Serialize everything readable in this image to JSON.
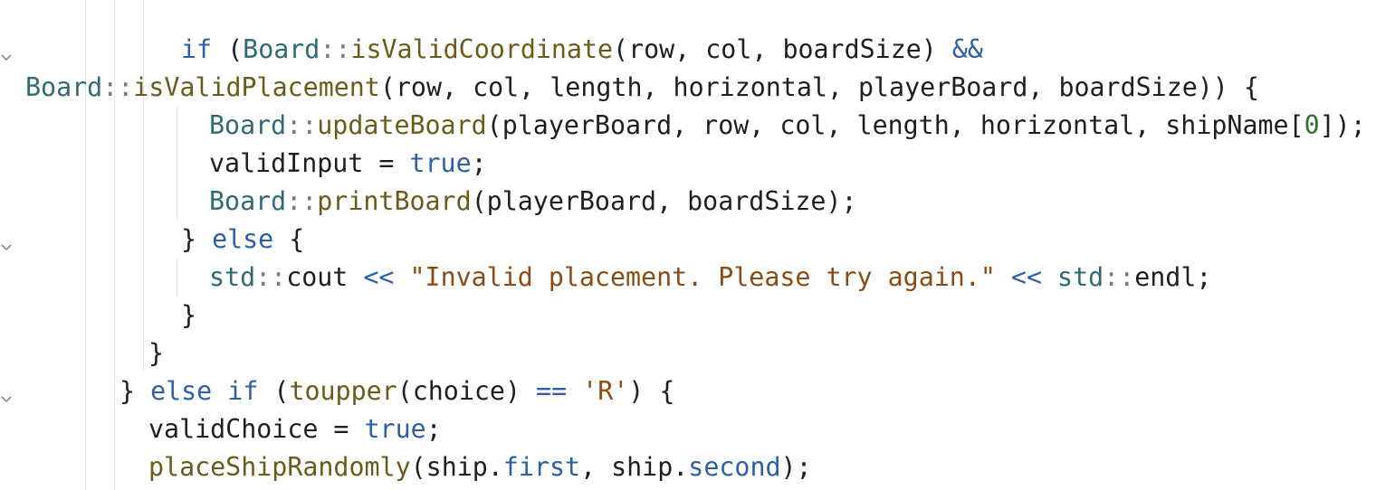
{
  "editor": {
    "colors": {
      "keyword": "#2b5fa8",
      "type": "#2e6a76",
      "function": "#6b5b1b",
      "string": "#8a4b14",
      "number": "#2f6e2f",
      "plain": "#1f1f1f"
    },
    "fold_markers": [
      "chevron-down-icon",
      "chevron-down-icon",
      "chevron-down-icon"
    ],
    "lines": [
      {
        "tokens": [
          {
            "t": "if",
            "c": "kw"
          },
          {
            "t": " (",
            "c": "pl"
          },
          {
            "t": "Board",
            "c": "typ"
          },
          {
            "t": "::",
            "c": "pu"
          },
          {
            "t": "isValidCoordinate",
            "c": "fn"
          },
          {
            "t": "(row, col, boardSize) ",
            "c": "pl"
          },
          {
            "t": "&&",
            "c": "op"
          }
        ]
      },
      {
        "tokens": [
          {
            "t": "Board",
            "c": "typ"
          },
          {
            "t": "::",
            "c": "pu"
          },
          {
            "t": "isValidPlacement",
            "c": "fn"
          },
          {
            "t": "(row, col, length, horizontal, playerBoard, boardSize)) {",
            "c": "pl"
          }
        ]
      },
      {
        "tokens": [
          {
            "t": "Board",
            "c": "typ"
          },
          {
            "t": "::",
            "c": "pu"
          },
          {
            "t": "updateBoard",
            "c": "fn"
          },
          {
            "t": "(playerBoard, row, col, length, horizontal, shipName[",
            "c": "pl"
          },
          {
            "t": "0",
            "c": "num"
          },
          {
            "t": "]);",
            "c": "pl"
          }
        ]
      },
      {
        "tokens": [
          {
            "t": "validInput = ",
            "c": "pl"
          },
          {
            "t": "true",
            "c": "kw"
          },
          {
            "t": ";",
            "c": "pl"
          }
        ]
      },
      {
        "tokens": [
          {
            "t": "Board",
            "c": "typ"
          },
          {
            "t": "::",
            "c": "pu"
          },
          {
            "t": "printBoard",
            "c": "fn"
          },
          {
            "t": "(playerBoard, boardSize);",
            "c": "pl"
          }
        ]
      },
      {
        "tokens": [
          {
            "t": "} ",
            "c": "pl"
          },
          {
            "t": "else",
            "c": "kw"
          },
          {
            "t": " {",
            "c": "pl"
          }
        ]
      },
      {
        "tokens": [
          {
            "t": "std",
            "c": "typ"
          },
          {
            "t": "::",
            "c": "pu"
          },
          {
            "t": "cout ",
            "c": "pl"
          },
          {
            "t": "<<",
            "c": "op"
          },
          {
            "t": " ",
            "c": "pl"
          },
          {
            "t": "\"Invalid placement. Please try again.\"",
            "c": "str"
          },
          {
            "t": " ",
            "c": "pl"
          },
          {
            "t": "<<",
            "c": "op"
          },
          {
            "t": " ",
            "c": "pl"
          },
          {
            "t": "std",
            "c": "typ"
          },
          {
            "t": "::",
            "c": "pu"
          },
          {
            "t": "endl;",
            "c": "pl"
          }
        ]
      },
      {
        "tokens": [
          {
            "t": "}",
            "c": "pl"
          }
        ]
      },
      {
        "tokens": [
          {
            "t": "}",
            "c": "pl"
          }
        ]
      },
      {
        "tokens": [
          {
            "t": "} ",
            "c": "pl"
          },
          {
            "t": "else",
            "c": "kw"
          },
          {
            "t": " ",
            "c": "pl"
          },
          {
            "t": "if",
            "c": "kw"
          },
          {
            "t": " (",
            "c": "pl"
          },
          {
            "t": "toupper",
            "c": "fn"
          },
          {
            "t": "(choice) ",
            "c": "pl"
          },
          {
            "t": "==",
            "c": "op"
          },
          {
            "t": " ",
            "c": "pl"
          },
          {
            "t": "'R'",
            "c": "str"
          },
          {
            "t": ") {",
            "c": "pl"
          }
        ]
      },
      {
        "tokens": [
          {
            "t": "validChoice = ",
            "c": "pl"
          },
          {
            "t": "true",
            "c": "kw"
          },
          {
            "t": ";",
            "c": "pl"
          }
        ]
      },
      {
        "tokens": [
          {
            "t": "placeShipRandomly",
            "c": "fn"
          },
          {
            "t": "(ship.",
            "c": "pl"
          },
          {
            "t": "first",
            "c": "mem"
          },
          {
            "t": ", ship.",
            "c": "pl"
          },
          {
            "t": "second",
            "c": "mem"
          },
          {
            "t": ");",
            "c": "pl"
          }
        ]
      }
    ]
  }
}
